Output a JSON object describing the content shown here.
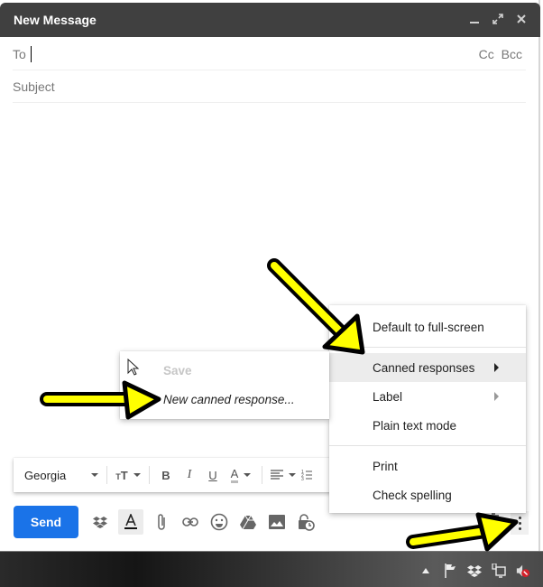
{
  "compose": {
    "title": "New Message",
    "controls": {
      "minimize": "minimize-icon",
      "fullscreen": "expand-icon",
      "close": "close-icon"
    },
    "to_label": "To",
    "to_value": "",
    "cc_label": "Cc",
    "bcc_label": "Bcc",
    "subject_placeholder": "Subject",
    "body": ""
  },
  "more_options_menu": {
    "items": [
      {
        "label": "Default to full-screen",
        "has_submenu": false,
        "highlighted": false
      },
      {
        "label": "Canned responses",
        "has_submenu": true,
        "highlighted": true
      },
      {
        "label": "Label",
        "has_submenu": true,
        "highlighted": false
      },
      {
        "label": "Plain text mode",
        "has_submenu": false,
        "highlighted": false
      },
      {
        "label": "Print",
        "has_submenu": false,
        "highlighted": false
      },
      {
        "label": "Check spelling",
        "has_submenu": false,
        "highlighted": false
      }
    ]
  },
  "canned_responses_submenu": {
    "items": [
      {
        "label": "Save",
        "disabled": true
      },
      {
        "label": "New canned response...",
        "disabled": false
      }
    ]
  },
  "formatting_toolbar": {
    "font": "Georgia",
    "size_icon": "text-size-icon",
    "bold": "B",
    "italic": "I",
    "underline": "U",
    "text_color": "A",
    "align_icon": "align-icon",
    "numbered_list_icon": "numbered-list-icon"
  },
  "bottom_toolbar": {
    "send_label": "Send",
    "icons": [
      "dropbox-icon",
      "formatting-options-icon",
      "attach-icon",
      "link-icon",
      "emoji-icon",
      "drive-icon",
      "photo-icon",
      "confidential-mode-icon"
    ],
    "discard_icon": "trash-icon",
    "more_icon": "more-options-icon"
  },
  "taskbar": {
    "tray_icons": [
      "show-hidden-icons",
      "action-center-flag-icon",
      "dropbox-tray-icon",
      "network-icon",
      "volume-muted-icon"
    ]
  },
  "colors": {
    "titlebar": "#404040",
    "send_button": "#1a73e8",
    "annotation_arrow": "#ffff00"
  }
}
